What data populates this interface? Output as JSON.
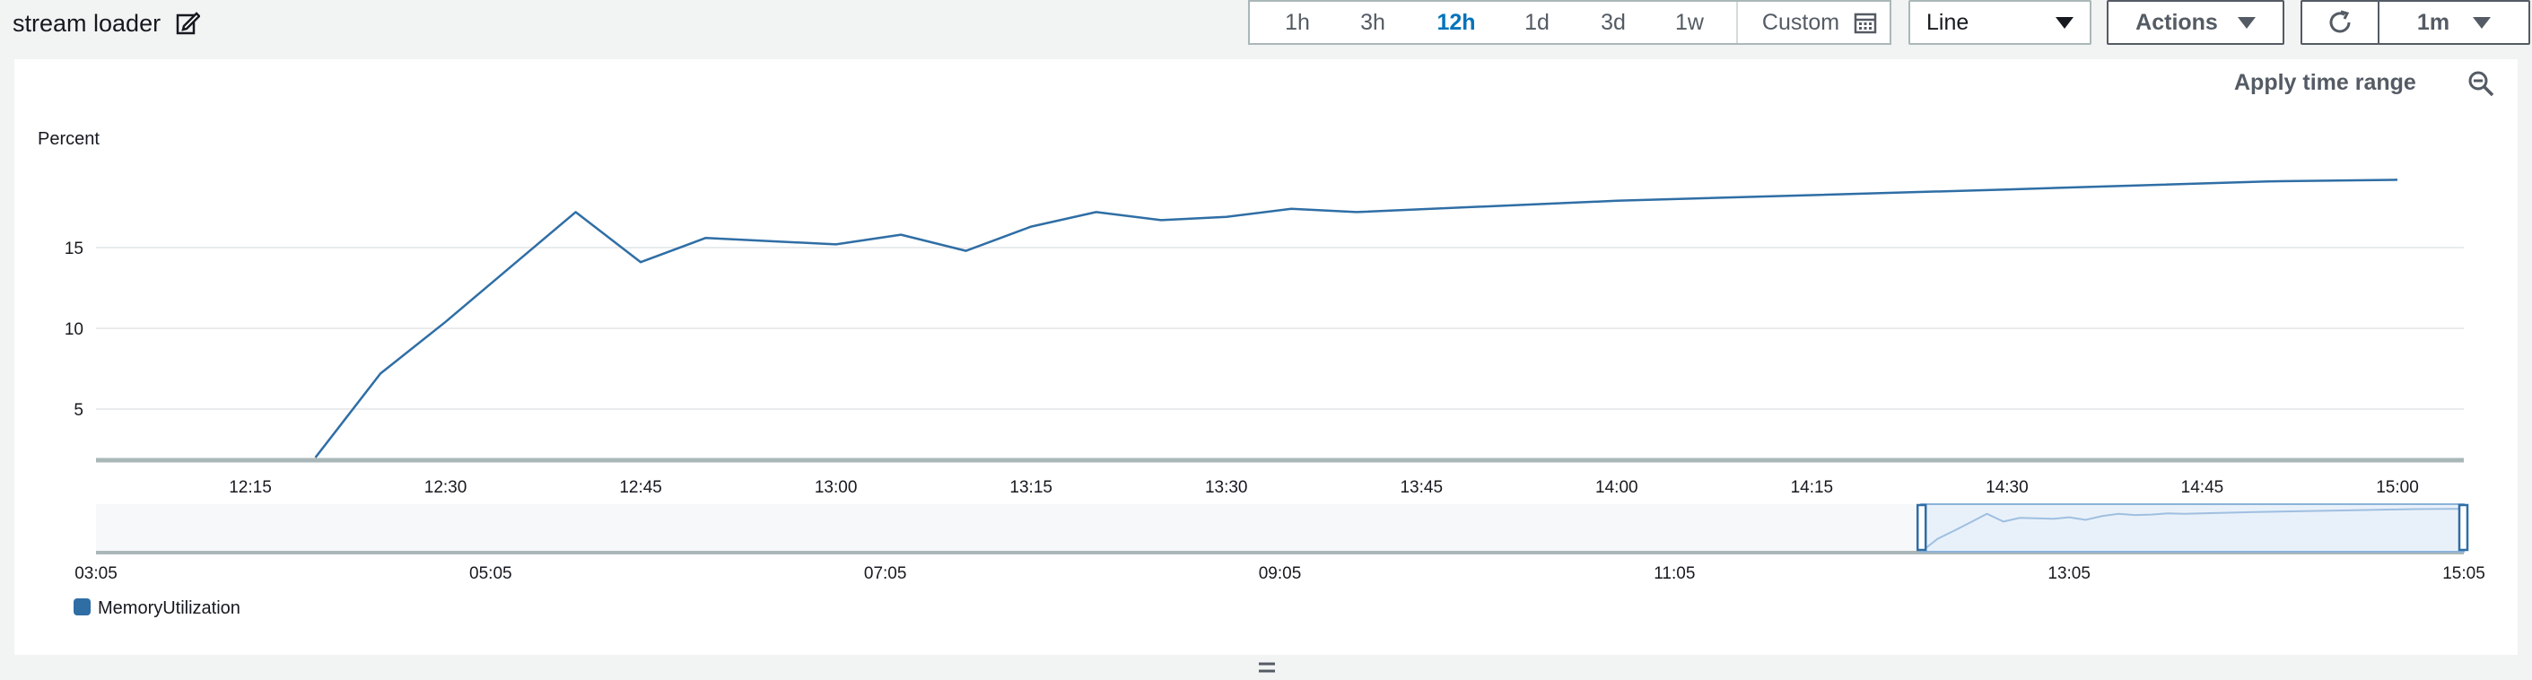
{
  "header": {
    "title": "stream loader",
    "time_ranges": [
      "1h",
      "3h",
      "12h",
      "1d",
      "3d",
      "1w"
    ],
    "active_time_range": "12h",
    "custom_label": "Custom",
    "chart_type_select": "Line",
    "actions_label": "Actions",
    "refresh_interval": "1m"
  },
  "panel": {
    "apply_time_range_label": "Apply time range"
  },
  "colors": {
    "series": "#2f6ea5",
    "accent": "#0073bb"
  },
  "chart_data": {
    "type": "line",
    "ylabel": "Percent",
    "yticks": [
      5,
      10,
      15
    ],
    "ylim": [
      2,
      20
    ],
    "xticks": [
      "12:15",
      "12:30",
      "12:45",
      "13:00",
      "13:15",
      "13:30",
      "13:45",
      "14:00",
      "14:15",
      "14:30",
      "14:45",
      "15:00"
    ],
    "xlim": [
      "12:15",
      "15:00"
    ],
    "series": [
      {
        "name": "MemoryUtilization",
        "x": [
          "12:20",
          "12:25",
          "12:30",
          "12:35",
          "12:40",
          "12:45",
          "12:50",
          "13:00",
          "13:05",
          "13:10",
          "13:15",
          "13:20",
          "13:25",
          "13:30",
          "13:35",
          "13:40",
          "14:00",
          "14:30",
          "14:50",
          "15:00"
        ],
        "values": [
          2,
          7.2,
          10.4,
          13.8,
          17.2,
          14.1,
          15.6,
          15.2,
          15.8,
          14.8,
          16.3,
          17.2,
          16.7,
          16.9,
          17.4,
          17.2,
          17.9,
          18.6,
          19.1,
          19.2
        ]
      }
    ],
    "navigator": {
      "xticks": [
        "03:05",
        "05:05",
        "07:05",
        "09:05",
        "11:05",
        "13:05",
        "15:05"
      ],
      "selection": [
        "12:20",
        "15:05"
      ]
    },
    "legend": "bottom-left"
  }
}
